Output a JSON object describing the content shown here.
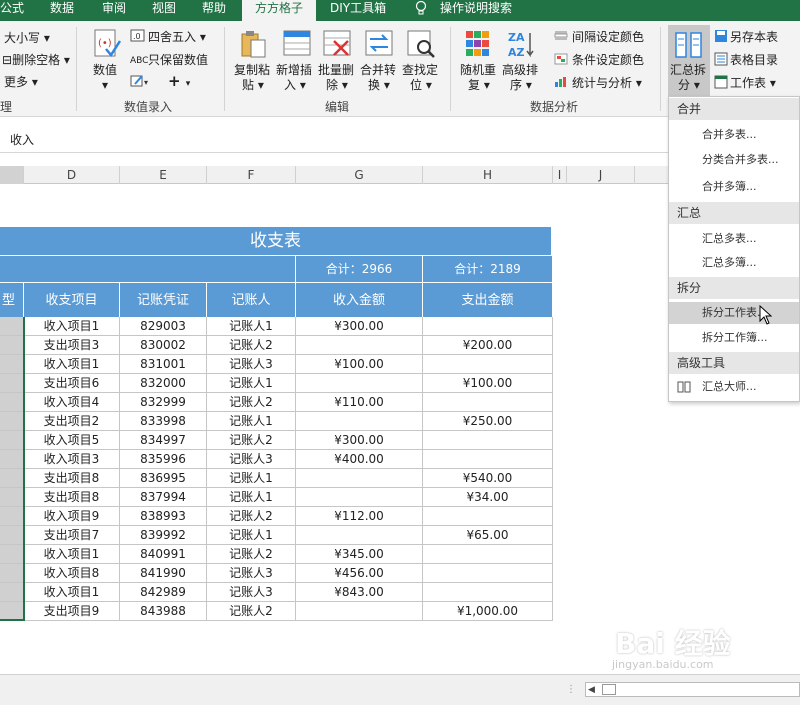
{
  "tabs": [
    "公式",
    "数据",
    "审阅",
    "视图",
    "帮助",
    "方方格子",
    "DIY工具箱",
    "操作说明搜索"
  ],
  "active_tab": "方方格子",
  "ribbon": {
    "left": {
      "case": "大小写",
      "remove_space": "删除空格",
      "more": "更多",
      "group": "理"
    },
    "number_entry": {
      "value_label1": "数值",
      "round": "四舍五入",
      "keep_value": "只保留数值",
      "group": "数值录入"
    },
    "edit": {
      "copy_paste_1": "复制粘",
      "copy_paste_2": "贴",
      "new_insert_1": "新增插",
      "new_insert_2": "入",
      "batch_delete_1": "批量删",
      "batch_delete_2": "除",
      "merge_convert_1": "合并转",
      "merge_convert_2": "换",
      "find_locate_1": "查找定",
      "find_locate_2": "位",
      "group": "编辑"
    },
    "analysis": {
      "random_dup_1": "随机重",
      "random_dup_2": "复",
      "adv_sort_1": "高级排",
      "adv_sort_2": "序",
      "interval_color": "间隔设定颜色",
      "cond_color": "条件设定颜色",
      "stat_analysis": "统计与分析",
      "group": "数据分析"
    },
    "summary": {
      "split_1": "汇总拆",
      "split_2": "分",
      "save_as": "另存本表",
      "toc": "表格目录",
      "worksheet": "工作表"
    }
  },
  "formula_bar": {
    "value": "收入"
  },
  "columns": [
    "D",
    "E",
    "F",
    "G",
    "H",
    "I",
    "J"
  ],
  "table": {
    "title": "收支表",
    "total_income": "合计：2966",
    "total_expense": "合计：2189",
    "partial_header": "型",
    "headers": [
      "收支项目",
      "记账凭证",
      "记账人",
      "收入金额",
      "支出金额"
    ],
    "rows": [
      [
        "收入项目1",
        "829003",
        "记账人1",
        "¥300.00",
        ""
      ],
      [
        "支出项目3",
        "830002",
        "记账人2",
        "",
        "¥200.00"
      ],
      [
        "收入项目1",
        "831001",
        "记账人3",
        "¥100.00",
        ""
      ],
      [
        "支出项目6",
        "832000",
        "记账人1",
        "",
        "¥100.00"
      ],
      [
        "收入项目4",
        "832999",
        "记账人2",
        "¥110.00",
        ""
      ],
      [
        "支出项目2",
        "833998",
        "记账人1",
        "",
        "¥250.00"
      ],
      [
        "收入项目5",
        "834997",
        "记账人2",
        "¥300.00",
        ""
      ],
      [
        "收入项目3",
        "835996",
        "记账人3",
        "¥400.00",
        ""
      ],
      [
        "支出项目8",
        "836995",
        "记账人1",
        "",
        "¥540.00"
      ],
      [
        "支出项目8",
        "837994",
        "记账人1",
        "",
        "¥34.00"
      ],
      [
        "收入项目9",
        "838993",
        "记账人2",
        "¥112.00",
        ""
      ],
      [
        "支出项目7",
        "839992",
        "记账人1",
        "",
        "¥65.00"
      ],
      [
        "收入项目1",
        "840991",
        "记账人2",
        "¥345.00",
        ""
      ],
      [
        "收入项目8",
        "841990",
        "记账人3",
        "¥456.00",
        ""
      ],
      [
        "收入项目1",
        "842989",
        "记账人3",
        "¥843.00",
        ""
      ],
      [
        "支出项目9",
        "843988",
        "记账人2",
        "",
        "¥1,000.00"
      ]
    ]
  },
  "dropdown": {
    "sections": [
      {
        "title": "合并",
        "items": [
          "合并多表...",
          "分类合并多表...",
          "合并多簿..."
        ]
      },
      {
        "title": "汇总",
        "items": [
          "汇总多表...",
          "汇总多簿..."
        ]
      },
      {
        "title": "拆分",
        "items": [
          "拆分工作表...",
          "拆分工作簿..."
        ]
      },
      {
        "title": "高级工具",
        "items": [
          "汇总大师..."
        ]
      }
    ],
    "highlighted": "拆分工作表..."
  },
  "watermark": {
    "logo": "Bai 经验",
    "url": "jingyan.baidu.com"
  },
  "colors": {
    "excel_green": "#217346",
    "table_header": "#5b9bd5",
    "selection_green": "#217346"
  }
}
